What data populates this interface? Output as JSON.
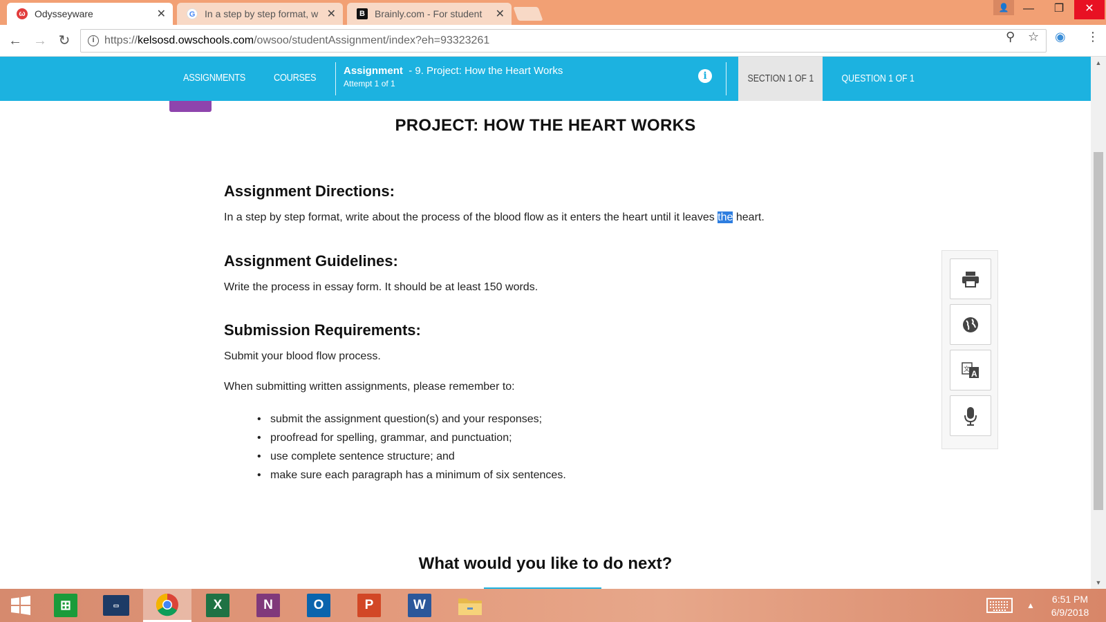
{
  "browser": {
    "tabs": [
      {
        "title": "Odysseyware",
        "active": true
      },
      {
        "title": "In a step by step format, w",
        "active": false
      },
      {
        "title": "Brainly.com - For student",
        "active": false
      }
    ],
    "url_prefix": "https://",
    "url_domain": "kelsosd.owschools.com",
    "url_path": "/owsoo/studentAssignment/index?eh=93323261"
  },
  "app_header": {
    "nav": [
      "ASSIGNMENTS",
      "COURSES"
    ],
    "assignment_label": "Assignment",
    "assignment_title": "- 9. Project: How the Heart Works",
    "attempt": "Attempt 1 of 1",
    "section": "SECTION 1 OF 1",
    "question": "QUESTION 1 OF 1"
  },
  "content": {
    "title": "PROJECT: HOW THE HEART WORKS",
    "directions_heading": "Assignment Directions:",
    "directions_text_before": "In a step by step format, write about the process of the blood flow as it enters the heart until it leaves ",
    "directions_text_highlight": "the",
    "directions_text_after": " heart.",
    "guidelines_heading": "Assignment Guidelines:",
    "guidelines_text": "Write the process in essay form. It should be at least 150 words.",
    "submission_heading": "Submission Requirements:",
    "submission_text": "Submit your blood flow process.",
    "reminder_intro": "When submitting written assignments, please remember to:",
    "reminders": [
      "submit the assignment question(s) and your responses;",
      "proofread for spelling, grammar, and punctuation;",
      "use complete sentence structure; and",
      "make sure each paragraph has a minimum of six sentences."
    ],
    "next_heading": "What would you like to do next?"
  },
  "tools": [
    "print-icon",
    "globe-icon",
    "translate-icon",
    "microphone-icon"
  ],
  "taskbar": {
    "apps": [
      "start-icon",
      "store-icon",
      "lenovo-icon",
      "chrome-icon",
      "excel-icon",
      "onenote-icon",
      "outlook-icon",
      "powerpoint-icon",
      "word-icon",
      "file-explorer-icon"
    ],
    "time": "6:51 PM",
    "date": "6/9/2018"
  },
  "colors": {
    "header_blue": "#1cb2e0",
    "tab_bar": "#f2a074",
    "selection": "#2e7ee0",
    "purple_tab": "#8e44ad"
  }
}
